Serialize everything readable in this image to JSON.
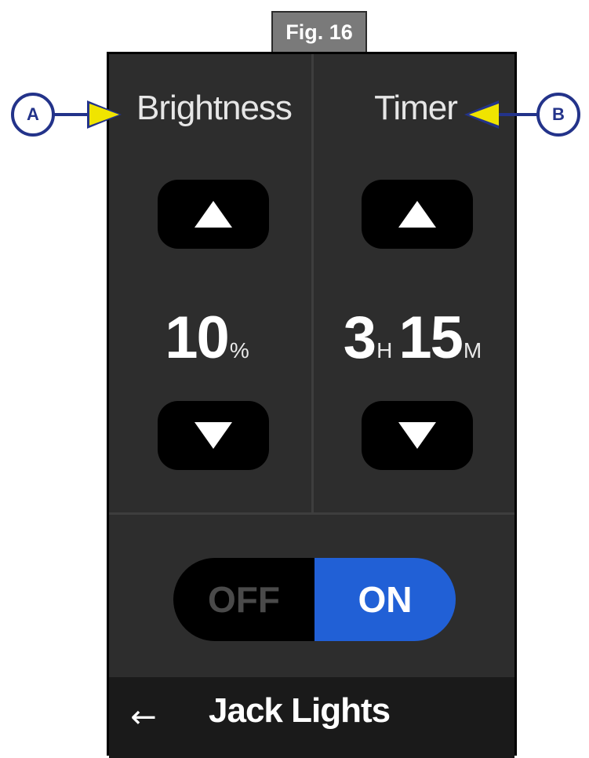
{
  "figure": {
    "label": "Fig. 16"
  },
  "brightness": {
    "title": "Brightness",
    "value": "10",
    "unit": "%"
  },
  "timer": {
    "title": "Timer",
    "hours": "3",
    "hours_unit": "H",
    "minutes": "15",
    "minutes_unit": "M"
  },
  "toggle": {
    "off_label": "OFF",
    "on_label": "ON",
    "state": "on"
  },
  "footer": {
    "back_icon": "←",
    "title": "Jack Lights"
  },
  "callouts": {
    "a": "A",
    "b": "B"
  },
  "colors": {
    "accent_on": "#2160d6",
    "callout": "#23338a",
    "pointer": "#f0e400"
  }
}
